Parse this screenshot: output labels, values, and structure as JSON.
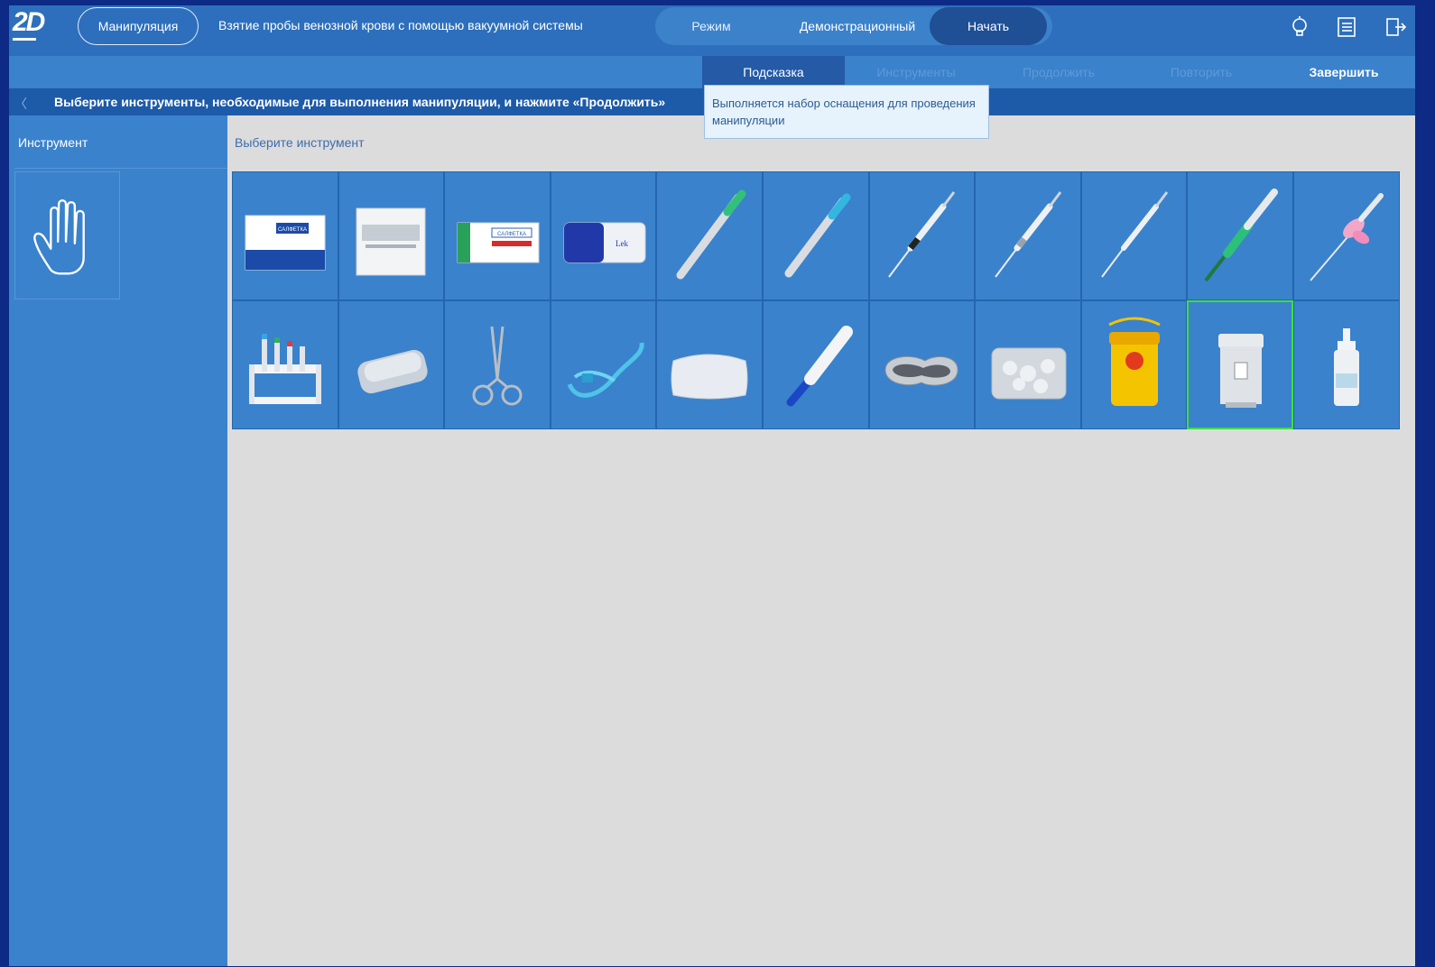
{
  "header": {
    "logo": "2D",
    "manipulation_button": "Манипуляция",
    "title": "Взятие пробы венозной крови с помощью вакуумной системы",
    "mode_label": "Режим",
    "mode_value": "Демонстрационный",
    "start_button": "Начать",
    "icons": [
      "lightbulb-icon",
      "checklist-icon",
      "exit-icon"
    ]
  },
  "tabs": {
    "hint": "Подсказка",
    "instruments": "Инструменты",
    "continue": "Продолжить",
    "repeat": "Повторить",
    "finish": "Завершить",
    "active": "hint"
  },
  "instruction": {
    "text": "Выберите инструменты, необходимые для выполнения манипуляции, и нажмите «Продолжить»"
  },
  "tooltip": {
    "text": "Выполняется набор оснащения для проведения манипуляции"
  },
  "left_panel": {
    "header": "Инструмент",
    "selected_tool_icon": "glove-hand-icon"
  },
  "main": {
    "header": "Выберите инструмент",
    "tools_row1": [
      {
        "icon": "wipe-package-icon",
        "label_text": "САЛФЕТКА"
      },
      {
        "icon": "sterile-pack-icon"
      },
      {
        "icon": "alcohol-wipe-icon",
        "label_text": "САЛФЕТКА"
      },
      {
        "icon": "gauze-pack-icon",
        "label_text": "Lek"
      },
      {
        "icon": "needle-green-cap-icon"
      },
      {
        "icon": "needle-blue-cap-icon"
      },
      {
        "icon": "syringe-icon"
      },
      {
        "icon": "syringe-icon"
      },
      {
        "icon": "syringe-icon"
      },
      {
        "icon": "vacutainer-needle-green-icon"
      },
      {
        "icon": "butterfly-needle-icon"
      }
    ],
    "tools_row2": [
      {
        "icon": "test-tube-rack-icon"
      },
      {
        "icon": "sterilizer-box-icon"
      },
      {
        "icon": "forceps-icon"
      },
      {
        "icon": "tourniquet-icon"
      },
      {
        "icon": "pillow-icon"
      },
      {
        "icon": "tube-holder-icon"
      },
      {
        "icon": "kidney-tray-icon"
      },
      {
        "icon": "cotton-balls-bag-icon"
      },
      {
        "icon": "sharps-container-icon"
      },
      {
        "icon": "waste-bin-icon",
        "selected": true
      },
      {
        "icon": "antiseptic-bottle-icon"
      }
    ]
  },
  "colors": {
    "outer": "#0d2a86",
    "panel": "#3a82cc",
    "active_tab": "#245aa6",
    "instruction_bar": "#1d5aa8",
    "work_area": "#dcdcdc",
    "selected_border": "#3be03b"
  }
}
